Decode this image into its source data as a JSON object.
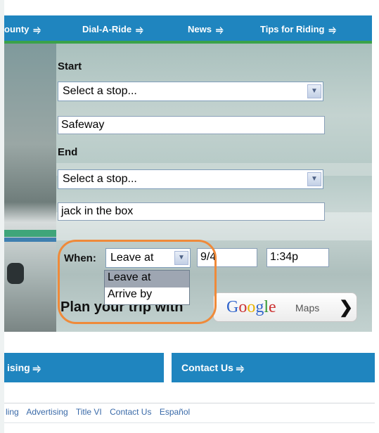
{
  "top_nav": {
    "items": [
      {
        "label": "ounty",
        "arrow": "⥤"
      },
      {
        "label": "Dial-A-Ride",
        "arrow": "⥤"
      },
      {
        "label": "News",
        "arrow": "⥤"
      },
      {
        "label": "Tips for Riding",
        "arrow": "⥤"
      }
    ]
  },
  "trip_planner": {
    "start_label": "Start",
    "start_select_value": "Select a stop...",
    "start_input_value": "Safeway",
    "end_label": "End",
    "end_select_value": "Select a stop...",
    "end_input_value": "jack in the box",
    "when_label": "When:",
    "when_select_value": "Leave at",
    "when_options": [
      "Leave at",
      "Arrive by"
    ],
    "date_value": "9/4",
    "time_value": "1:34p",
    "plan_text": "Plan your trip with",
    "google_logo_letters": [
      "G",
      "o",
      "o",
      "g",
      "l",
      "e"
    ],
    "maps_label": "Maps",
    "go_glyph": "❯"
  },
  "bottom_nav": {
    "items": [
      {
        "label": "ising",
        "arrow": "⥤"
      },
      {
        "label": "Contact Us",
        "arrow": "⥤"
      }
    ]
  },
  "footer_links": [
    "ling",
    "Advertising",
    "Title VI",
    "Contact Us",
    "Español"
  ],
  "colors": {
    "nav_blue": "#1f85bf",
    "nav_green": "#3aa24a",
    "highlight_orange": "#ef8a3a"
  },
  "icons": {
    "select_arrow": "chevron-down-icon",
    "nav_arrow": "right-arrow-icon",
    "maps_go": "chevron-right-icon"
  }
}
